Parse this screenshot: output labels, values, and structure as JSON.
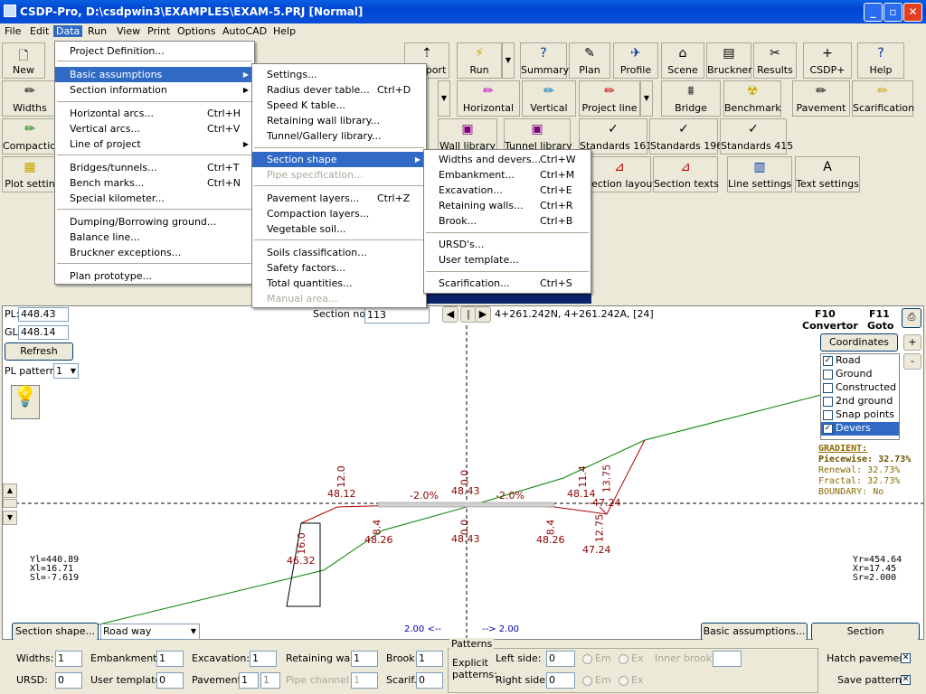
{
  "window": {
    "title": "CSDP-Pro, D:\\csdpwin3\\EXAMPLES\\EXAM-5.PRJ [Normal]"
  },
  "menubar": [
    "File",
    "Edit",
    "Data",
    "Run",
    "View",
    "Print",
    "Options",
    "AutoCAD",
    "Help"
  ],
  "toolbar1": {
    "new": "New",
    "port": "port",
    "run": "Run",
    "summary": "Summary",
    "plan": "Plan",
    "profile": "Profile",
    "scene": "Scene",
    "bruckner": "Bruckner",
    "results": "Results",
    "csdp": "CSDP+",
    "help": "Help"
  },
  "toolbar2": {
    "widths": "Widths",
    "horizontal": "Horizontal",
    "vertical": "Vertical",
    "project_line": "Project line",
    "bridge": "Bridge",
    "benchmark": "Benchmark",
    "pavement": "Pavement",
    "scarification": "Scarification"
  },
  "toolbar3": {
    "compaction": "Compaction",
    "wall_library": "Wall library",
    "tunnel_library": "Tunnel library",
    "std161": "Standards 161",
    "std196": "Standards 196",
    "std415": "Standards 415"
  },
  "toolbar4": {
    "plot_settings": "Plot settin",
    "section_layout": "Section layout",
    "section_texts": "Section texts",
    "line_settings": "Line settings",
    "text_settings": "Text settings"
  },
  "data_menu": [
    {
      "label": "Project Definition...",
      "shortcut": ""
    },
    {
      "label": "Basic assumptions",
      "shortcut": "",
      "submenu": true,
      "selected": true
    },
    {
      "label": "Section information",
      "shortcut": "",
      "submenu": true
    },
    {
      "label": "Horizontal arcs...",
      "shortcut": "Ctrl+H"
    },
    {
      "label": "Vertical arcs...",
      "shortcut": "Ctrl+V"
    },
    {
      "label": "Line of project",
      "shortcut": "",
      "submenu": true
    },
    {
      "label": "Bridges/tunnels...",
      "shortcut": "Ctrl+T"
    },
    {
      "label": "Bench marks...",
      "shortcut": "Ctrl+N"
    },
    {
      "label": "Special kilometer...",
      "shortcut": ""
    },
    {
      "label": "Dumping/Borrowing ground...",
      "shortcut": ""
    },
    {
      "label": "Balance line...",
      "shortcut": ""
    },
    {
      "label": "Bruckner exceptions...",
      "shortcut": ""
    },
    {
      "label": "Plan prototype...",
      "shortcut": ""
    }
  ],
  "basic_menu": [
    {
      "label": "Settings...",
      "shortcut": ""
    },
    {
      "label": "Radius dever table...",
      "shortcut": "Ctrl+D"
    },
    {
      "label": "Speed K table...",
      "shortcut": ""
    },
    {
      "label": "Retaining wall library...",
      "shortcut": ""
    },
    {
      "label": "Tunnel/Gallery library...",
      "shortcut": ""
    },
    {
      "label": "Section shape",
      "shortcut": "",
      "submenu": true,
      "selected": true
    },
    {
      "label": "Pipe specification...",
      "shortcut": "",
      "disabled": true
    },
    {
      "label": "Pavement layers...",
      "shortcut": "Ctrl+Z"
    },
    {
      "label": "Compaction layers...",
      "shortcut": ""
    },
    {
      "label": "Vegetable soil...",
      "shortcut": ""
    },
    {
      "label": "Soils classification...",
      "shortcut": ""
    },
    {
      "label": "Safety factors...",
      "shortcut": ""
    },
    {
      "label": "Total quantities...",
      "shortcut": ""
    },
    {
      "label": "Manual area...",
      "shortcut": "",
      "disabled": true
    }
  ],
  "shape_menu": [
    {
      "label": "Widths and devers...",
      "shortcut": "Ctrl+W"
    },
    {
      "label": "Embankment...",
      "shortcut": "Ctrl+M"
    },
    {
      "label": "Excavation...",
      "shortcut": "Ctrl+E"
    },
    {
      "label": "Retaining walls...",
      "shortcut": "Ctrl+R"
    },
    {
      "label": "Brook...",
      "shortcut": "Ctrl+B"
    },
    {
      "label": "URSD's...",
      "shortcut": ""
    },
    {
      "label": "User template...",
      "shortcut": ""
    },
    {
      "label": "Scarification...",
      "shortcut": "Ctrl+S"
    }
  ],
  "view": {
    "pl_label": "PL:",
    "pl_value": "448.43",
    "gl_label": "GL:",
    "gl_value": "448.14",
    "refresh": "Refresh",
    "pl_pattern_label": "PL pattern:",
    "pl_pattern_value": "1",
    "section_no_label": "Section no.:",
    "section_no_value": "113",
    "station": "4+261.242N, 4+261.242A, [24]",
    "f10": "F10",
    "convertor": "Convertor",
    "f11": "F11",
    "goto": "Goto",
    "coordinates_btn": "Coordinates Off",
    "plus": "+",
    "minus": "-",
    "layers": [
      {
        "label": "Road",
        "checked": true
      },
      {
        "label": "Ground",
        "checked": false
      },
      {
        "label": "Constructed",
        "checked": false
      },
      {
        "label": "2nd ground",
        "checked": false
      },
      {
        "label": "Snap points",
        "checked": false
      },
      {
        "label": "Devers",
        "checked": true
      }
    ],
    "gradient": {
      "title": "GRADIENT:",
      "piecewise": "Piecewise: 32.73%",
      "renewal": "Renewal: 32.73%",
      "fractal": "Fractal: 32.73%",
      "boundary": "BOUNDARY: No"
    },
    "left_info": [
      "Yl=440.89",
      "Xl=16.71",
      "Sl=-7.619"
    ],
    "right_info": [
      "Yr=454.64",
      "Xr=17.45",
      "Sr=2.000"
    ],
    "labels": {
      "a": "12.0",
      "b": "48.12",
      "c": "-2.0%",
      "d": "0.0",
      "e": "48.43",
      "f": "-2.0%",
      "g": "11.4",
      "h": "48.14",
      "i": "13.75",
      "j": "-47.24",
      "k": "8.4",
      "l": "48.26",
      "m": "0.0",
      "n": "48.43",
      "o": "8.4",
      "p": "48.26",
      "q": "12.75",
      "r": "47.24",
      "s": "16.0",
      "t": "46.32"
    },
    "scale_left": "2.00 <--",
    "scale_right": "--> 2.00",
    "section_shape_btn": "Section shape...",
    "road_way": "Road way",
    "basic_btn": "Basic assumptions...",
    "section_info_btn": "Section information..."
  },
  "bottom": {
    "widths_l": "Widths:",
    "widths_v": "1",
    "emb_l": "Embankment:",
    "emb_v": "1",
    "exc_l": "Excavation:",
    "exc_v": "1",
    "ret_l": "Retaining wall:",
    "ret_v": "1",
    "brook_l": "Brook:",
    "brook_v": "1",
    "ursd_l": "URSD:",
    "ursd_v": "0",
    "user_l": "User template:",
    "user_v": "0",
    "pav_l": "Pavement:",
    "pav_v1": "1",
    "pav_v2": "1",
    "pipe_l": "Pipe channel:",
    "pipe_v": "1",
    "scarif_l": "Scarif.:",
    "scarif_v": "0",
    "patterns": "Patterns",
    "explicit1": "Explicit",
    "explicit2": "patterns:",
    "left_side": "Left side:",
    "left_v": "0",
    "right_side": "Right side:",
    "right_v": "0",
    "em": "Em",
    "ex": "Ex",
    "inner_brook": "Inner brook:",
    "hatch": "Hatch pavement",
    "save": "Save patterns"
  },
  "colors": {
    "titlebar": "#0046d5",
    "menu_highlight": "#316ac5",
    "ground_line": "#008000",
    "road_line": "#b00000"
  }
}
